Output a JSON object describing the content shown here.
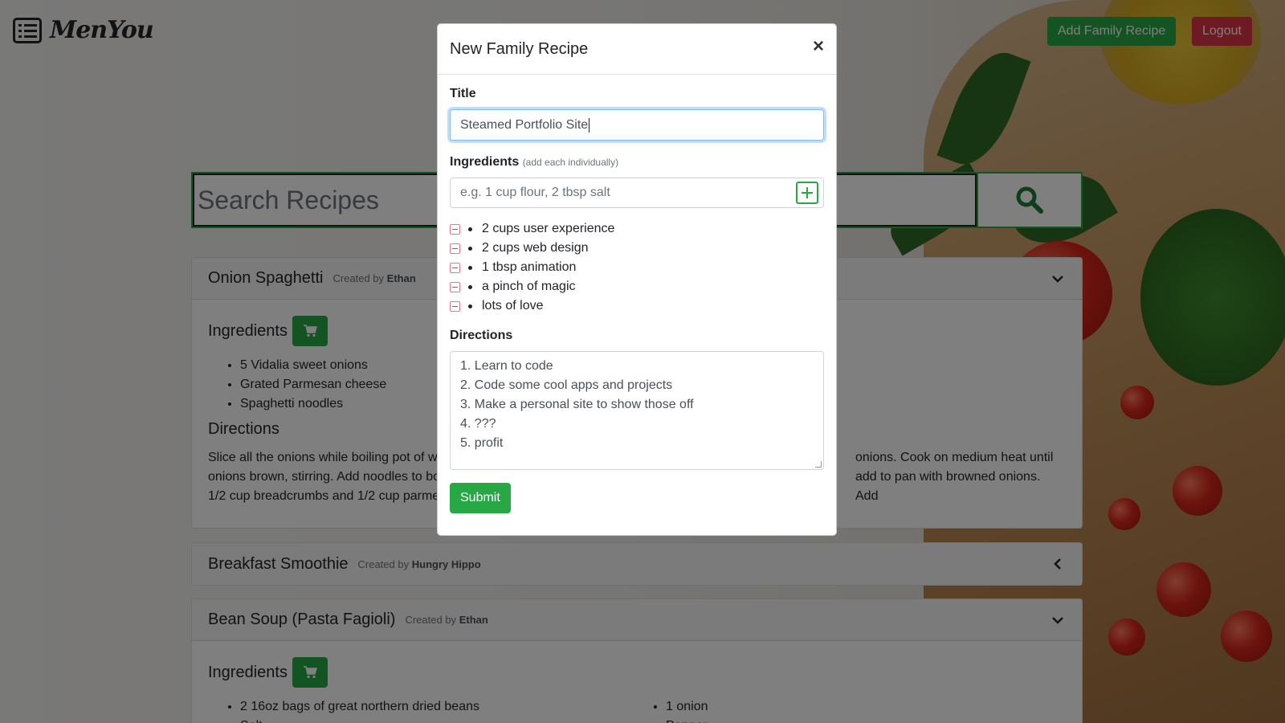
{
  "header": {
    "logo_icon": "list-icon",
    "brand": "MenYou",
    "add_button": "Add Family Recipe",
    "logout_button": "Logout"
  },
  "search": {
    "placeholder": "Search Recipes",
    "icon": "search-icon"
  },
  "recipes": [
    {
      "title": "Onion Spaghetti",
      "created_prefix": "Created by",
      "author": "Ethan",
      "expanded": true,
      "ingredients_heading": "Ingredients",
      "ingredients": [
        "5 Vidalia sweet onions",
        "Grated Parmesan cheese",
        "Spaghetti noodles"
      ],
      "directions_heading": "Directions",
      "directions_left": "Slice all the onions while boiling pot of w",
      "directions_left2": "onions brown, stirring. Add noodles to bo",
      "directions_left3": "1/2 cup breadcrumbs and 1/2 cup parme",
      "directions_right": "onions. Cook on medium heat until",
      "directions_right2": "add to pan with browned onions. Add"
    },
    {
      "title": "Breakfast Smoothie",
      "created_prefix": "Created by",
      "author": "Hungry Hippo",
      "expanded": false
    },
    {
      "title": "Bean Soup (Pasta Fagioli)",
      "created_prefix": "Created by",
      "author": "Ethan",
      "expanded": true,
      "ingredients_heading": "Ingredients",
      "ingredients_col1": [
        "2 16oz bags of great northern dried beans",
        "Salt"
      ],
      "ingredients_col2": [
        "1 onion",
        "Pepper"
      ]
    }
  ],
  "modal": {
    "title": "New Family Recipe",
    "close": "×",
    "title_label": "Title",
    "title_value": "Steamed Portfolio Site",
    "ingredients_label": "Ingredients",
    "ingredients_hint": "(add each individually)",
    "ingredients_placeholder": "e.g. 1 cup flour, 2 tbsp salt",
    "ingredients": [
      "2 cups user experience",
      "2 cups web design",
      "1 tbsp animation",
      "a pinch of magic",
      "lots of love"
    ],
    "directions_label": "Directions",
    "directions": [
      "1. Learn to code",
      "2. Code some cool apps and projects",
      "3. Make a personal site to show those off",
      "4. ???",
      "5. profit"
    ],
    "submit": "Submit"
  },
  "colors": {
    "success": "#28a745",
    "danger": "#dc3545",
    "focus": "#80bdff"
  }
}
